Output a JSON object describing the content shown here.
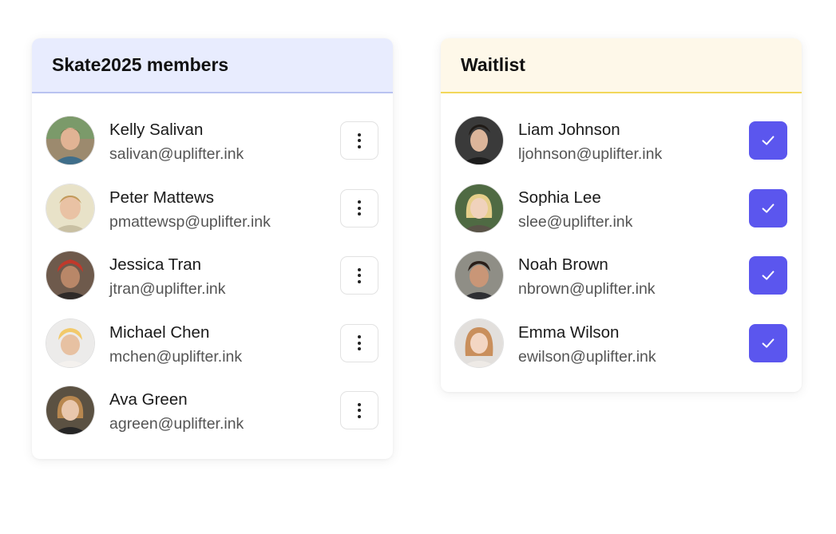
{
  "members": {
    "title": "Skate2025 members",
    "items": [
      {
        "name": "Kelly Salivan",
        "email": "salivan@uplifter.ink"
      },
      {
        "name": "Peter Mattews",
        "email": "pmattewsp@uplifter.ink"
      },
      {
        "name": "Jessica Tran",
        "email": "jtran@uplifter.ink"
      },
      {
        "name": "Michael Chen",
        "email": "mchen@uplifter.ink"
      },
      {
        "name": "Ava Green",
        "email": "agreen@uplifter.ink"
      }
    ]
  },
  "waitlist": {
    "title": "Waitlist",
    "items": [
      {
        "name": "Liam Johnson",
        "email": "ljohnson@uplifter.ink",
        "checked": true
      },
      {
        "name": "Sophia Lee",
        "email": "slee@uplifter.ink",
        "checked": true
      },
      {
        "name": "Noah Brown",
        "email": "nbrown@uplifter.ink",
        "checked": true
      },
      {
        "name": "Emma Wilson",
        "email": "ewilson@uplifter.ink",
        "checked": true
      }
    ]
  },
  "icons": {
    "more": "more-vertical-icon",
    "check": "checkmark-icon"
  },
  "colors": {
    "members_header_bg": "#e8ecfe",
    "members_header_border": "#b9c3f0",
    "waitlist_header_bg": "#fef8e9",
    "waitlist_header_border": "#f2d75a",
    "accent": "#5b56ee"
  }
}
